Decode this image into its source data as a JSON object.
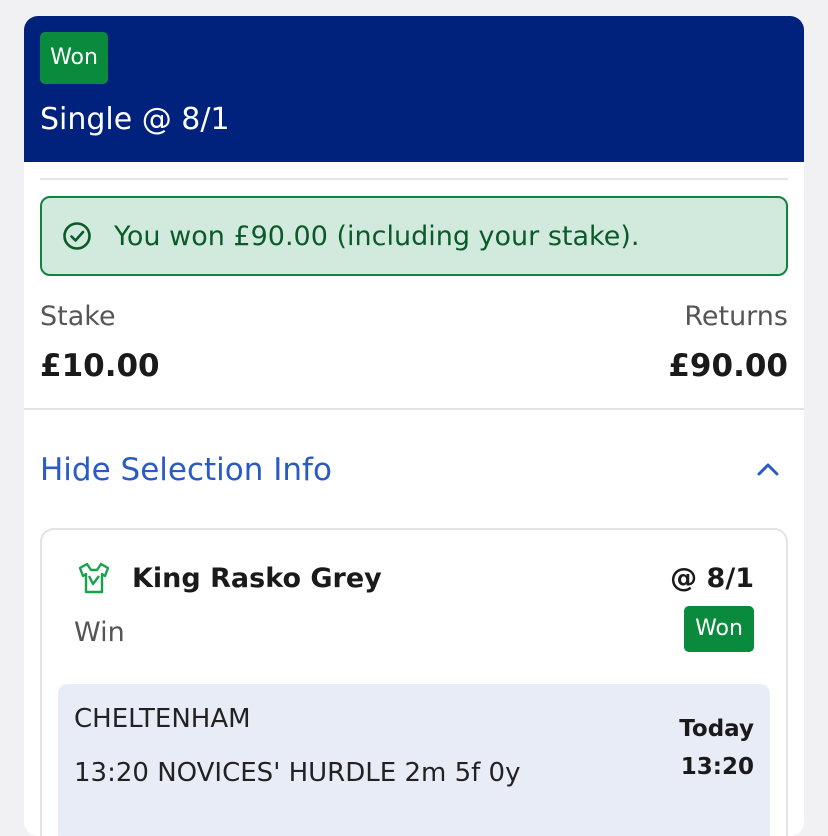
{
  "header": {
    "status_badge": "Won",
    "title": "Single @ 8/1"
  },
  "result_banner": {
    "icon": "check-circle-icon",
    "text": "You won £90.00 (including your stake)."
  },
  "summary": {
    "stake_label": "Stake",
    "stake_value": "£10.00",
    "returns_label": "Returns",
    "returns_value": "£90.00"
  },
  "selection_toggle": {
    "label": "Hide Selection Info",
    "icon": "chevron-up-icon"
  },
  "selection": {
    "icon": "silk-icon",
    "name": "King Rasko Grey",
    "odds": "@ 8/1",
    "bet_type": "Win",
    "status_badge": "Won",
    "event": {
      "course": "CHELTENHAM",
      "race": "13:20 NOVICES' HURDLE 2m 5f 0y",
      "day": "Today",
      "time": "13:20"
    }
  },
  "colors": {
    "header_bg": "#01227c",
    "won_badge": "#0a8a3c",
    "banner_bg": "#d2eadd",
    "banner_border": "#12833f",
    "link": "#2a5bc5",
    "event_bg": "#e8ecf7"
  }
}
